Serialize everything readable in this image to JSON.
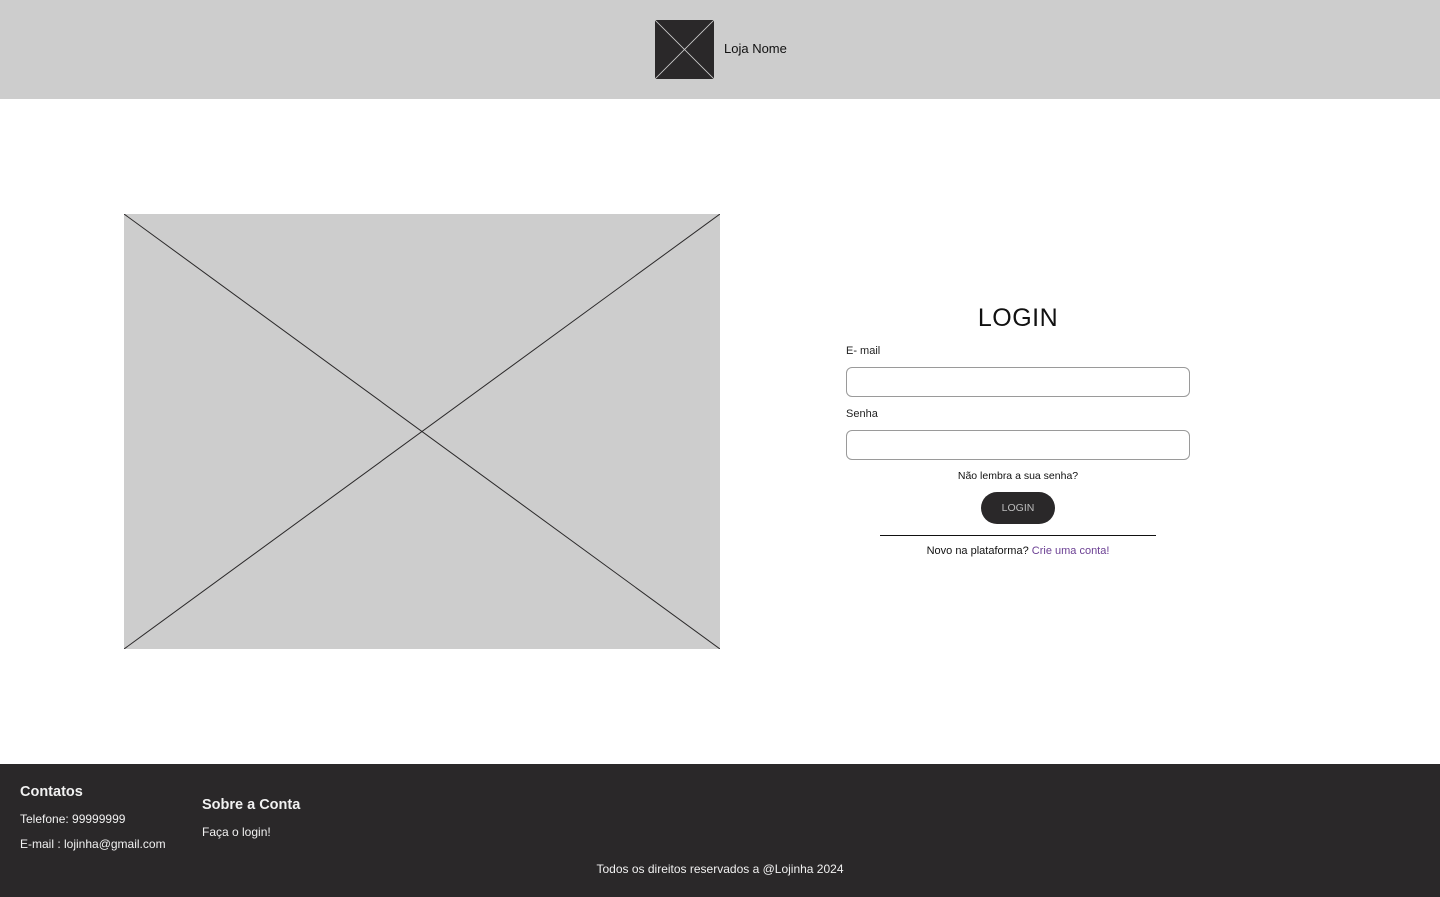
{
  "header": {
    "logo_icon": "image-placeholder-icon",
    "store_name": "Loja Nome",
    "background": "#cdcdcd"
  },
  "hero": {
    "icon": "image-placeholder-icon",
    "background": "#cdcdcd"
  },
  "login_form": {
    "title": "LOGIN",
    "email_label": "E- mail",
    "email_value": "",
    "password_label": "Senha",
    "password_value": "",
    "forgot_password": "Não lembra a sua senha?",
    "submit_label": "LOGIN",
    "signup_prompt": "Novo na plataforma?",
    "signup_link": "Crie uma conta!",
    "accent_color": "#6b3f93",
    "button_color": "#2a2829"
  },
  "footer": {
    "background": "#2a2829",
    "contacts": {
      "heading": "Contatos",
      "phone": "Telefone:  99999999",
      "email": "E-mail : lojinha@gmail.com"
    },
    "about": {
      "heading": "Sobre a Conta",
      "login_link": "Faça o login!"
    },
    "copyright": "Todos os direitos reservados a @Lojinha 2024"
  }
}
